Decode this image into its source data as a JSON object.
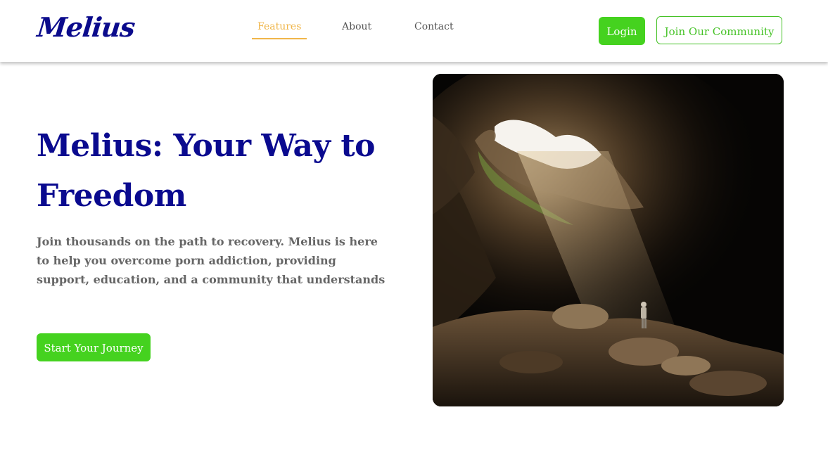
{
  "brand": {
    "logo_text": "Melius"
  },
  "nav": {
    "links": [
      {
        "label": "Features",
        "active": true
      },
      {
        "label": "About",
        "active": false
      },
      {
        "label": "Contact",
        "active": false
      }
    ]
  },
  "header_actions": {
    "login_label": "Login",
    "join_label": "Join Our Community"
  },
  "hero": {
    "title": "Melius: Your Way to Freedom",
    "description": "Join thousands on the path to recovery. Melius is here to help you overcome porn addiction, providing support, education, and a community that understands",
    "cta_label": "Start Your Journey",
    "image_subject": "cave-with-light-and-hiker"
  },
  "colors": {
    "brand_blue": "#0a0a8f",
    "accent_green": "#45d21f",
    "active_link": "#f0b64a",
    "body_text": "#666666"
  }
}
